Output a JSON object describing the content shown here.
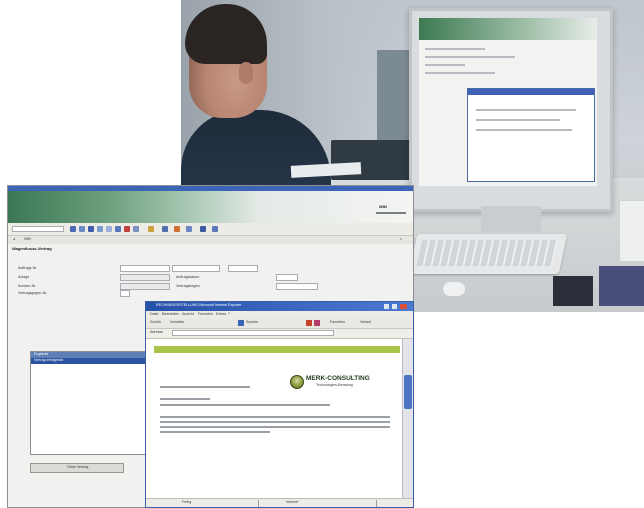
{
  "colors": {
    "titlebar_blue": "#3c65b8",
    "banner_green": "#3b7754",
    "logo_green": "#a8c44a",
    "selection_blue": "#2b53a2"
  },
  "app": {
    "banner_text": "WIN",
    "nav_text": "NIM",
    "section_title": "Wagenflusss-Vertrag",
    "form_labels": [
      "Auftrags-Nr.",
      "Anlage",
      "Kunden-Nr.",
      "Vertragsgegen-Nr."
    ],
    "form_labels_right": [
      "Auftragsdatum",
      "Vertragsbeginn"
    ],
    "results_header": "Ergebnis",
    "results_row": "Vertrag erfolgreich",
    "ok_button": "Ohne Vertrag",
    "icons": [
      "new-icon",
      "open-icon",
      "save-icon",
      "print-icon",
      "cut-icon",
      "copy-icon",
      "paste-icon",
      "delete-icon",
      "search-icon",
      "help-icon"
    ]
  },
  "popup": {
    "title": "RECHNUNGSSTELLUNG-Microsoft Internet Explorer",
    "menu": [
      "Datei",
      "Bearbeiten",
      "Ansicht",
      "Favoriten",
      "Extras",
      "?"
    ],
    "toolbar": [
      "Zurück",
      "Vorwärts",
      "Suchen",
      "Favoriten",
      "Verlauf"
    ],
    "address_label": "Adresse",
    "company_name": "MERK-CONSULTING",
    "company_tagline": "Technologies-Beratung",
    "status_left": "Fertig",
    "status_right": "Internet"
  }
}
